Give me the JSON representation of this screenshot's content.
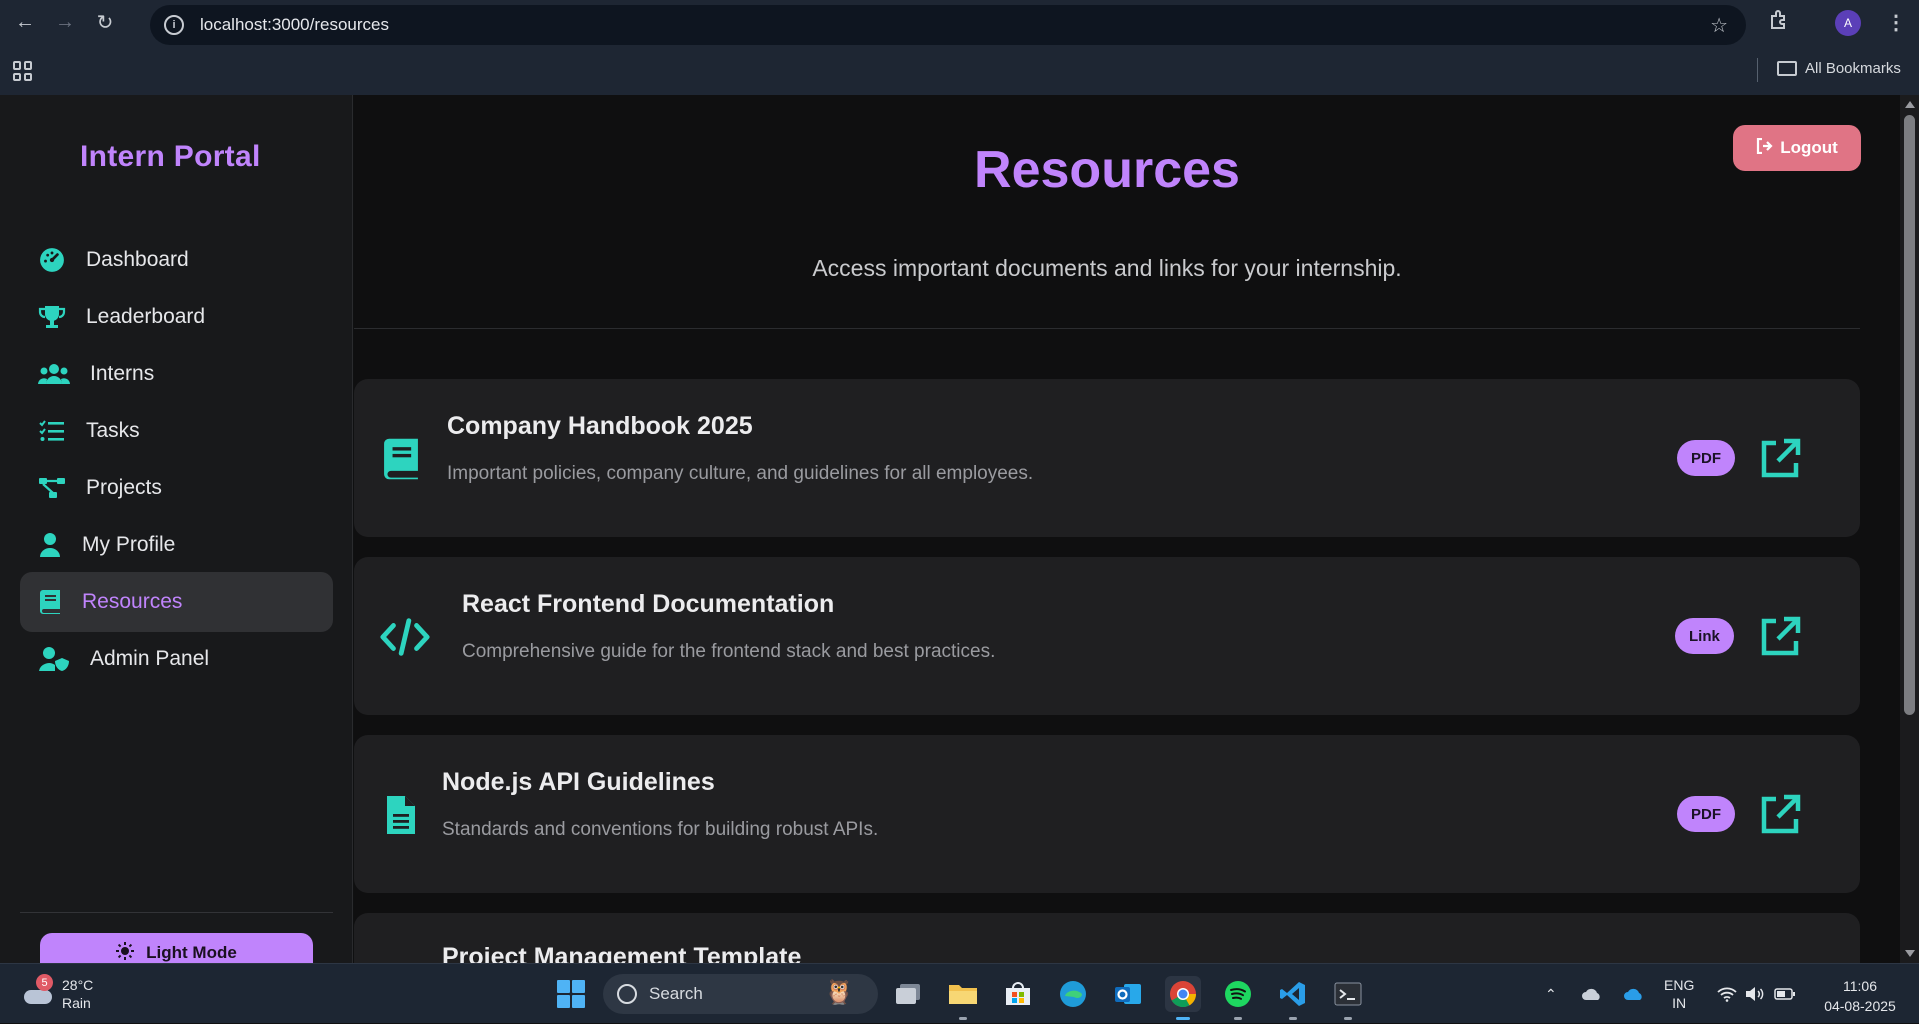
{
  "browser": {
    "url": "localhost:3000/resources",
    "profile_initial": "A",
    "bookmarks_label": "All Bookmarks"
  },
  "sidebar": {
    "brand": "Intern Portal",
    "items": [
      {
        "label": "Dashboard",
        "icon": "dashboard-gauge-icon"
      },
      {
        "label": "Leaderboard",
        "icon": "trophy-icon"
      },
      {
        "label": "Interns",
        "icon": "users-icon"
      },
      {
        "label": "Tasks",
        "icon": "task-list-icon"
      },
      {
        "label": "Projects",
        "icon": "project-diagram-icon"
      },
      {
        "label": "My Profile",
        "icon": "user-icon"
      },
      {
        "label": "Resources",
        "icon": "book-icon",
        "active": true
      },
      {
        "label": "Admin Panel",
        "icon": "user-shield-icon"
      }
    ],
    "light_mode_label": "Light Mode"
  },
  "header": {
    "logout_label": "Logout",
    "title": "Resources",
    "subtitle": "Access important documents and links for your internship."
  },
  "resources": [
    {
      "title": "Company Handbook 2025",
      "description": "Important policies, company culture, and guidelines for all employees.",
      "badge": "PDF",
      "icon": "book-icon"
    },
    {
      "title": "React Frontend Documentation",
      "description": "Comprehensive guide for the frontend stack and best practices.",
      "badge": "Link",
      "icon": "code-icon"
    },
    {
      "title": "Node.js API Guidelines",
      "description": "Standards and conventions for building robust APIs.",
      "badge": "PDF",
      "icon": "file-text-icon"
    },
    {
      "title": "Project Management Template",
      "description": "",
      "badge": "",
      "icon": ""
    }
  ],
  "taskbar": {
    "weather_temp": "28°C",
    "weather_desc": "Rain",
    "weather_badge": "5",
    "search_placeholder": "Search",
    "lang_line1": "ENG",
    "lang_line2": "IN",
    "time": "11:06",
    "date": "04-08-2025"
  },
  "colors": {
    "accent": "#c084fc",
    "teal": "#2dd4bf",
    "logout": "#e07485",
    "background": "#0f0f10",
    "card": "#1f1f21"
  }
}
